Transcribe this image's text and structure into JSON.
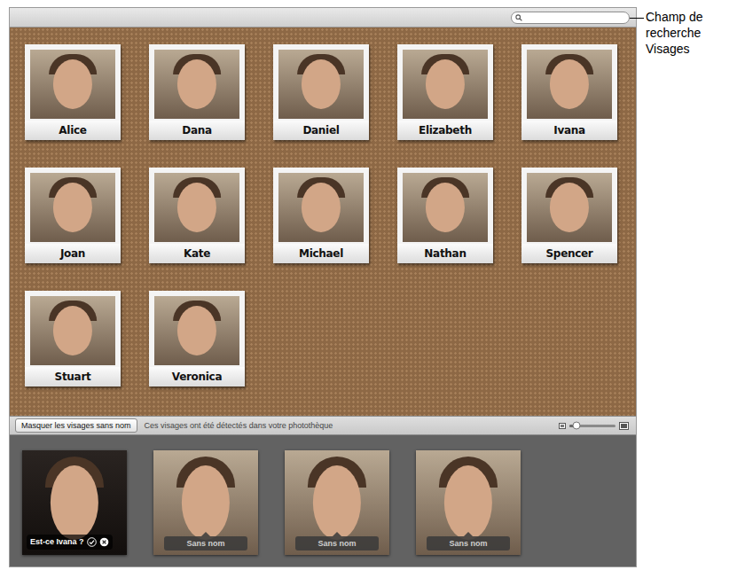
{
  "search": {
    "value": ""
  },
  "callout": {
    "text": "Champ de recherche Visages"
  },
  "named_faces": [
    {
      "name": "Alice"
    },
    {
      "name": "Dana"
    },
    {
      "name": "Daniel"
    },
    {
      "name": "Elizabeth"
    },
    {
      "name": "Ivana"
    },
    {
      "name": "Joan"
    },
    {
      "name": "Kate"
    },
    {
      "name": "Michael"
    },
    {
      "name": "Nathan"
    },
    {
      "name": "Spencer"
    },
    {
      "name": "Stuart"
    },
    {
      "name": "Veronica"
    }
  ],
  "toolbar": {
    "hide_button": "Masquer les visages sans nom",
    "info": "Ces visages ont été détectés dans votre photothèque"
  },
  "size_slider": {
    "level": 0.15
  },
  "unnamed_faces": [
    {
      "kind": "suggestion",
      "label": "Est-ce Ivana ?"
    },
    {
      "kind": "unnamed",
      "label": "Sans nom"
    },
    {
      "kind": "unnamed",
      "label": "Sans nom"
    },
    {
      "kind": "unnamed",
      "label": "Sans nom"
    }
  ]
}
